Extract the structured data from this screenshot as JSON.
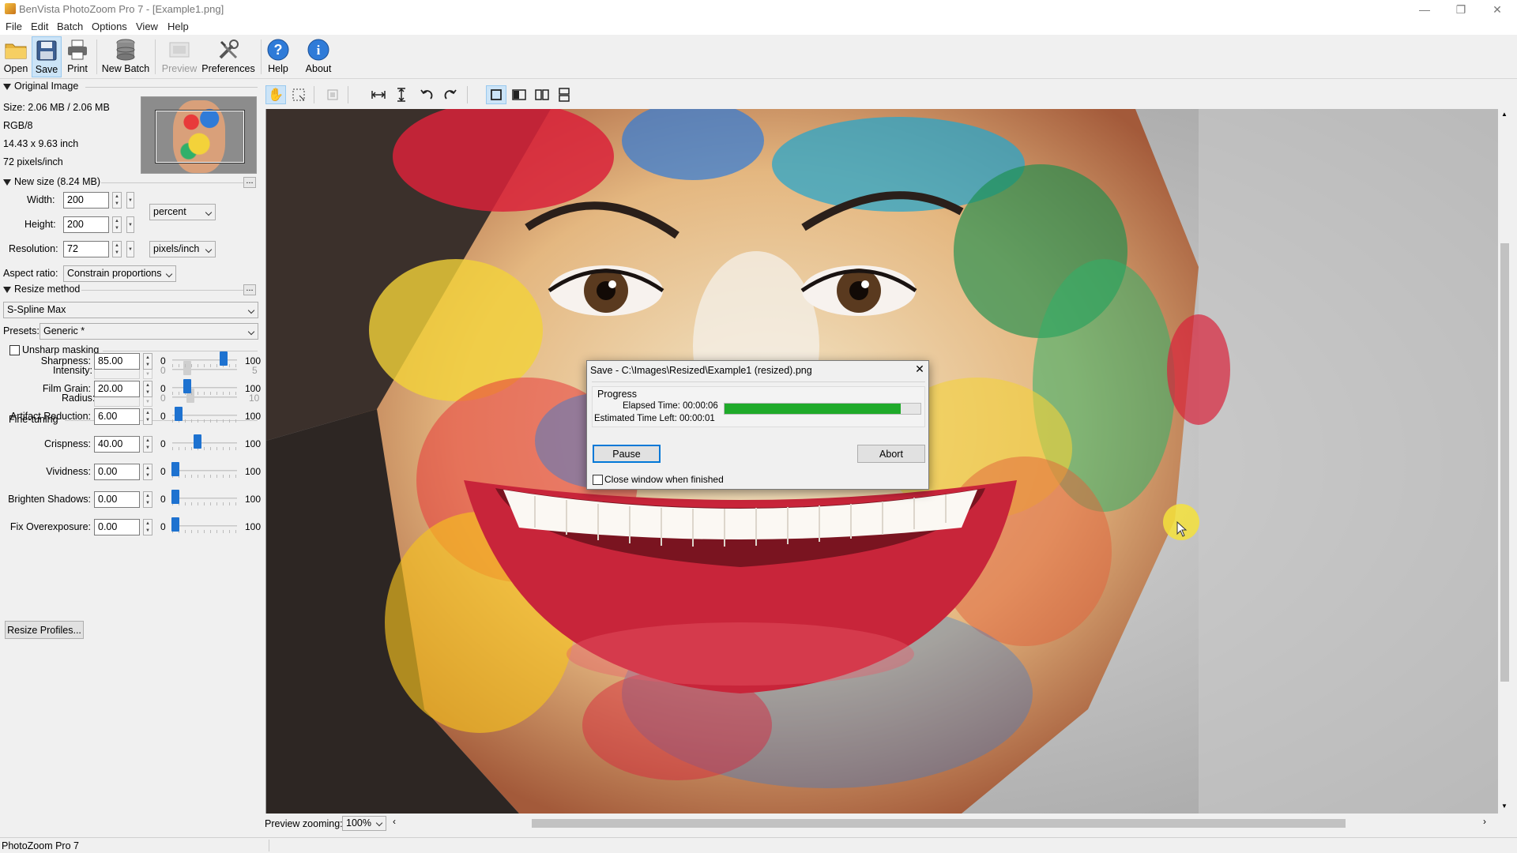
{
  "window": {
    "title": "BenVista PhotoZoom Pro 7 - [Example1.png]",
    "minimize": "—",
    "restore": "❐",
    "close": "✕"
  },
  "menu": [
    "File",
    "Edit",
    "Batch",
    "Options",
    "View",
    "Help"
  ],
  "toolbar": {
    "open": "Open",
    "save": "Save",
    "print": "Print",
    "new_batch": "New Batch",
    "preview": "Preview",
    "preferences": "Preferences",
    "help": "Help",
    "about": "About"
  },
  "original_image": {
    "header": "Original Image",
    "size": "Size: 2.06 MB / 2.06 MB",
    "mode": "RGB/8",
    "dimensions": "14.43 x 9.63 inch",
    "resolution": "72 pixels/inch"
  },
  "new_size": {
    "header": "New size (8.24 MB)",
    "more": "...",
    "width_label": "Width:",
    "width_value": "200",
    "height_label": "Height:",
    "height_value": "200",
    "unit": "percent",
    "resolution_label": "Resolution:",
    "resolution_value": "72",
    "resolution_unit": "pixels/inch",
    "aspect_label": "Aspect ratio:",
    "aspect_value": "Constrain proportions"
  },
  "resize_method": {
    "header": "Resize method",
    "more": "...",
    "method": "S-Spline Max",
    "presets_label": "Presets:",
    "presets_value": "Generic *"
  },
  "unsharp": {
    "label": "Unsharp masking",
    "checked": false,
    "intensity_label": "Intensity:",
    "intensity_min": "0",
    "intensity_max": "5",
    "radius_label": "Radius:",
    "radius_min": "0",
    "radius_max": "10"
  },
  "fine_tuning": {
    "header": "Fine-tuning",
    "rows": [
      {
        "label": "Sharpness:",
        "value": "85.00",
        "min": "0",
        "max": "100"
      },
      {
        "label": "Film Grain:",
        "value": "20.00",
        "min": "0",
        "max": "100"
      },
      {
        "label": "Artifact Reduction:",
        "value": "6.00",
        "min": "0",
        "max": "100"
      },
      {
        "label": "Crispness:",
        "value": "40.00",
        "min": "0",
        "max": "100"
      },
      {
        "label": "Vividness:",
        "value": "0.00",
        "min": "0",
        "max": "100"
      },
      {
        "label": "Brighten Shadows:",
        "value": "0.00",
        "min": "0",
        "max": "100"
      },
      {
        "label": "Fix Overexposure:",
        "value": "0.00",
        "min": "0",
        "max": "100"
      }
    ],
    "profiles_button": "Resize Profiles..."
  },
  "preview_zoom": {
    "label": "Preview zooming:",
    "value": "100%"
  },
  "status": "PhotoZoom Pro 7",
  "dialog": {
    "title": "Save - C:\\Images\\Resized\\Example1 (resized).png",
    "group": "Progress",
    "elapsed": "Elapsed Time: 00:00:06",
    "remaining": "Estimated Time Left: 00:00:01",
    "progress": 0.9,
    "progress_color": "#1faa2a",
    "pause": "Pause",
    "abort": "Abort",
    "close_when_finished": "Close window when finished",
    "close_checked": false
  },
  "colors": {
    "accent": "#1e72d0",
    "selection": "#cce4f7",
    "cursor_highlight": "#f5e23c"
  }
}
